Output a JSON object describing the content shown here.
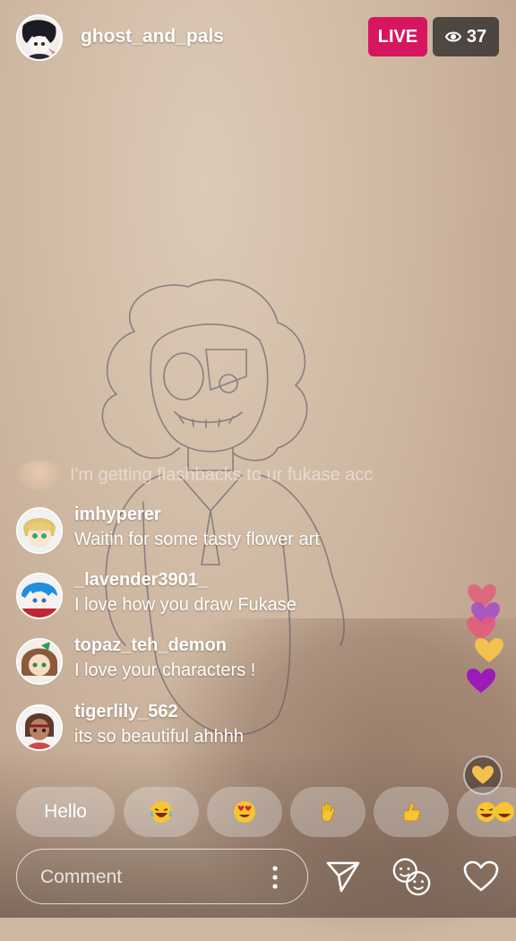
{
  "header": {
    "host_name": "ghost_and_pals",
    "live_label": "LIVE",
    "viewer_count": "37",
    "viewer_icon": "eye-icon"
  },
  "faded_comment": {
    "text": "I'm getting flashbacks to ur fukase acc"
  },
  "comments": [
    {
      "user": "imhyperer",
      "text": "Waitin for some tasty flower art"
    },
    {
      "user": "_lavender3901_",
      "text": "I love how you draw Fukase"
    },
    {
      "user": "topaz_teh_demon",
      "text": "I love your characters !"
    },
    {
      "user": "tigerlily_562",
      "text": "its so beautiful ahhhh"
    }
  ],
  "hearts": [
    {
      "color": "#e05f7a"
    },
    {
      "color": "#a64ac9"
    },
    {
      "color": "#e8597c"
    },
    {
      "color": "#f2c14e"
    },
    {
      "color": "#9b1bb8"
    }
  ],
  "quick_reactions": [
    {
      "label": "Hello",
      "icon": ""
    },
    {
      "label": "",
      "icon": "laughing-emoji-icon"
    },
    {
      "label": "",
      "icon": "heart-eyes-emoji-icon"
    },
    {
      "label": "",
      "icon": "waving-hand-icon"
    },
    {
      "label": "",
      "icon": "thumbs-up-icon"
    },
    {
      "label": "",
      "icon": "laughing-emoji-icon"
    }
  ],
  "bottom_bar": {
    "comment_placeholder": "Comment",
    "icons": [
      "more-vertical-icon",
      "send-icon",
      "people-icon",
      "heart-icon"
    ]
  },
  "colors": {
    "live_red": "#d6175f",
    "text": "#ffffff"
  }
}
